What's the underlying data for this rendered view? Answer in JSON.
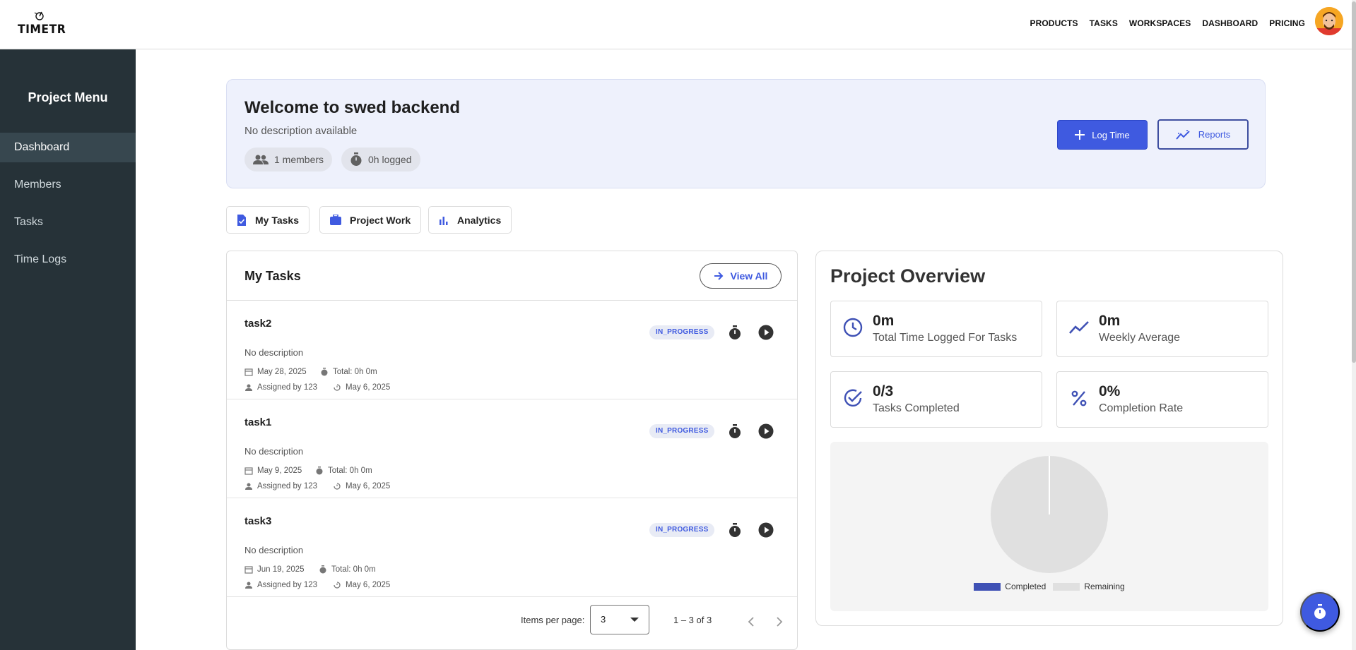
{
  "header": {
    "logo_text": "TIMETR",
    "nav": [
      "PRODUCTS",
      "TASKS",
      "WORKSPACES",
      "DASHBOARD",
      "PRICING"
    ]
  },
  "sidebar": {
    "title": "Project Menu",
    "items": [
      {
        "label": "Dashboard",
        "active": true
      },
      {
        "label": "Members",
        "active": false
      },
      {
        "label": "Tasks",
        "active": false
      },
      {
        "label": "Time Logs",
        "active": false
      }
    ]
  },
  "welcome": {
    "title": "Welcome to swed backend",
    "description": "No description available",
    "members_chip": "1 members",
    "logged_chip": "0h logged",
    "log_time_label": "Log Time",
    "reports_label": "Reports"
  },
  "tabs": [
    {
      "label": "My Tasks",
      "icon": "task-icon"
    },
    {
      "label": "Project Work",
      "icon": "briefcase-icon"
    },
    {
      "label": "Analytics",
      "icon": "bar-chart-icon"
    }
  ],
  "my_tasks": {
    "title": "My Tasks",
    "view_all_label": "View All",
    "tasks": [
      {
        "name": "task2",
        "description": "No description",
        "due": "May 28, 2025",
        "total": "Total: 0h 0m",
        "assigned": "Assigned by 123",
        "updated": "May 6, 2025",
        "status": "IN_PROGRESS"
      },
      {
        "name": "task1",
        "description": "No description",
        "due": "May 9, 2025",
        "total": "Total: 0h 0m",
        "assigned": "Assigned by 123",
        "updated": "May 6, 2025",
        "status": "IN_PROGRESS"
      },
      {
        "name": "task3",
        "description": "No description",
        "due": "Jun 19, 2025",
        "total": "Total: 0h 0m",
        "assigned": "Assigned by 123",
        "updated": "May 6, 2025",
        "status": "IN_PROGRESS"
      }
    ],
    "pager": {
      "items_per_page_label": "Items per page:",
      "items_per_page": "3",
      "range": "1 – 3 of 3"
    }
  },
  "overview": {
    "title": "Project Overview",
    "stats": [
      {
        "value": "0m",
        "label": "Total Time Logged For Tasks",
        "icon": "clock-icon"
      },
      {
        "value": "0m",
        "label": "Weekly Average",
        "icon": "trending-icon"
      },
      {
        "value": "0/3",
        "label": "Tasks Completed",
        "icon": "check-circle-icon"
      },
      {
        "value": "0%",
        "label": "Completion Rate",
        "icon": "percent-icon"
      }
    ]
  },
  "chart_data": {
    "type": "pie",
    "categories": [
      "Completed",
      "Remaining"
    ],
    "values": [
      0,
      3
    ],
    "colors": [
      "#3f51b5",
      "#e0e0e0"
    ],
    "legend": "bottom"
  },
  "colors": {
    "primary": "#3f5ae0",
    "sidebar": "#263238",
    "status_text": "#3f5ae0"
  }
}
